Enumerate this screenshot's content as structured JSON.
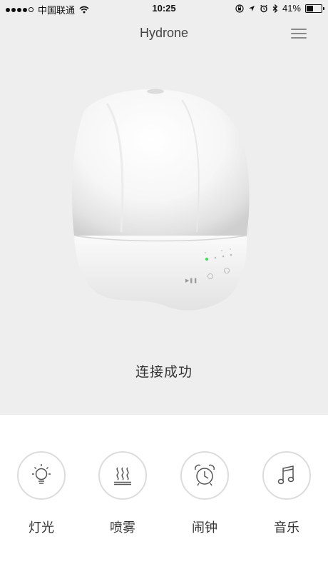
{
  "status_bar": {
    "carrier": "中国联通",
    "time": "10:25",
    "battery": "41%",
    "battery_level": 0.41,
    "signal_bars_filled": 4,
    "signal_bars_total": 5
  },
  "header": {
    "title": "Hydrone"
  },
  "device": {
    "panel_symbols": "▶❚❚"
  },
  "status_message": "连接成功",
  "controls": [
    {
      "label": "灯光",
      "icon": "light-bulb-icon"
    },
    {
      "label": "喷雾",
      "icon": "mist-icon"
    },
    {
      "label": "闹钟",
      "icon": "alarm-clock-icon"
    },
    {
      "label": "音乐",
      "icon": "music-note-icon"
    }
  ],
  "colors": {
    "top_background": "#efeeee",
    "icon_stroke": "#555555",
    "indicator_green": "#4cd964"
  }
}
